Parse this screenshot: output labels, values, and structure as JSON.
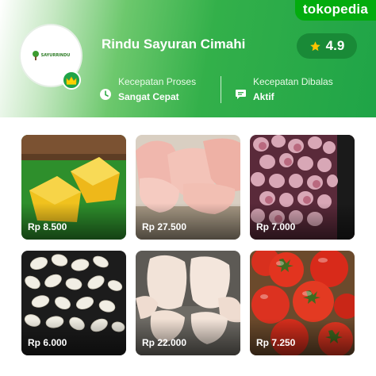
{
  "brand": {
    "name": "tokopedia"
  },
  "shop": {
    "name": "Rindu Sayuran Cimahi",
    "logo_text": "SAYURRINDU",
    "rating": "4.9",
    "stats": [
      {
        "label": "Kecepatan Proses",
        "value": "Sangat Cepat",
        "icon": "clock-icon"
      },
      {
        "label": "Kecepatan Dibalas",
        "value": "Aktif",
        "icon": "chat-icon"
      }
    ]
  },
  "colors": {
    "brand_green": "#03ac0e",
    "header_green": "#1fa447",
    "star": "#ffc400"
  },
  "products": [
    {
      "price": "Rp 8.500",
      "depicts": "yellow tofu"
    },
    {
      "price": "Rp 27.500",
      "depicts": "chicken thigh"
    },
    {
      "price": "Rp 7.000",
      "depicts": "shallots"
    },
    {
      "price": "Rp 6.000",
      "depicts": "peeled garlic"
    },
    {
      "price": "Rp 22.000",
      "depicts": "whole chicken"
    },
    {
      "price": "Rp 7.250",
      "depicts": "tomatoes"
    }
  ]
}
